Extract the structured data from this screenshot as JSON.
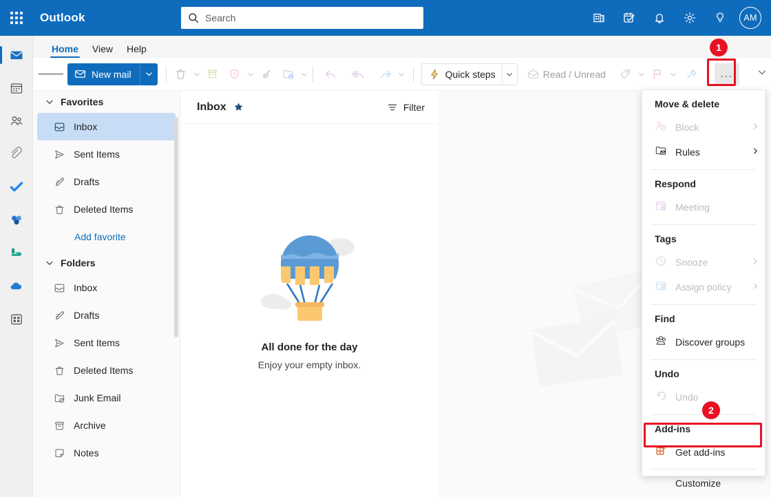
{
  "topbar": {
    "waffle_label": "App launcher",
    "brand": "Outlook",
    "search_placeholder": "Search",
    "search_value": "",
    "icons": [
      "teams-icon",
      "todo-tasks-icon",
      "notifications-bell-icon",
      "settings-gear-icon",
      "tips-lightbulb-icon"
    ],
    "avatar_initials": "AM"
  },
  "rail": {
    "items": [
      {
        "name": "mail",
        "active": true
      },
      {
        "name": "calendar",
        "active": false
      },
      {
        "name": "people",
        "active": false
      },
      {
        "name": "files",
        "active": false
      },
      {
        "name": "to-do",
        "active": false
      },
      {
        "name": "viva-engage",
        "active": false
      },
      {
        "name": "bookings",
        "active": false
      },
      {
        "name": "onedrive",
        "active": false
      },
      {
        "name": "apps",
        "active": false
      }
    ]
  },
  "ribbon": {
    "tabs": [
      {
        "label": "Home",
        "active": true
      },
      {
        "label": "View",
        "active": false
      },
      {
        "label": "Help",
        "active": false
      }
    ]
  },
  "toolbar": {
    "new_mail": "New mail",
    "delete_label": "Delete",
    "archive_label": "Archive",
    "report_label": "Report",
    "sweep_label": "Sweep",
    "move_to_label": "Move to",
    "reply_label": "Reply",
    "reply_all_label": "Reply all",
    "forward_label": "Forward",
    "quick_steps": "Quick steps",
    "read_unread": "Read / Unread",
    "categorize_label": "Categorize",
    "flag_label": "Flag",
    "pin_label": "Pin",
    "more_label": "...",
    "collapse_label": "Collapse ribbon"
  },
  "folder_pane": {
    "favorites": {
      "title": "Favorites",
      "items": [
        {
          "label": "Inbox",
          "icon": "inbox-icon",
          "selected": true
        },
        {
          "label": "Sent Items",
          "icon": "send-icon",
          "selected": false
        },
        {
          "label": "Drafts",
          "icon": "drafts-icon",
          "selected": false
        },
        {
          "label": "Deleted Items",
          "icon": "trash-icon",
          "selected": false
        }
      ],
      "add_favorite": "Add favorite"
    },
    "folders": {
      "title": "Folders",
      "items": [
        {
          "label": "Inbox",
          "icon": "inbox-icon"
        },
        {
          "label": "Drafts",
          "icon": "drafts-icon"
        },
        {
          "label": "Sent Items",
          "icon": "send-icon"
        },
        {
          "label": "Deleted Items",
          "icon": "trash-icon"
        },
        {
          "label": "Junk Email",
          "icon": "junk-folder-icon"
        },
        {
          "label": "Archive",
          "icon": "archive-icon"
        },
        {
          "label": "Notes",
          "icon": "notes-icon"
        }
      ]
    }
  },
  "message_list": {
    "title": "Inbox",
    "favorite_star": "star-icon",
    "filter_label": "Filter",
    "empty_title": "All done for the day",
    "empty_subtitle": "Enjoy your empty inbox."
  },
  "flyout_menu": {
    "sections": [
      {
        "title": "Move & delete",
        "items": [
          {
            "label": "Block",
            "icon": "block-person-icon",
            "disabled": true,
            "submenu": true
          },
          {
            "label": "Rules",
            "icon": "rules-folder-icon",
            "disabled": false,
            "submenu": true
          }
        ]
      },
      {
        "title": "Respond",
        "items": [
          {
            "label": "Meeting",
            "icon": "meeting-calendar-icon",
            "disabled": true,
            "submenu": false
          }
        ]
      },
      {
        "title": "Tags",
        "items": [
          {
            "label": "Snooze",
            "icon": "clock-icon",
            "disabled": true,
            "submenu": true
          },
          {
            "label": "Assign policy",
            "icon": "assign-policy-icon",
            "disabled": true,
            "submenu": true
          }
        ]
      },
      {
        "title": "Find",
        "items": [
          {
            "label": "Discover groups",
            "icon": "people-group-icon",
            "disabled": false,
            "submenu": false
          }
        ]
      },
      {
        "title": "Undo",
        "items": [
          {
            "label": "Undo",
            "icon": "undo-arrow-icon",
            "disabled": true,
            "submenu": false
          }
        ]
      },
      {
        "title": "Add-ins",
        "items": [
          {
            "label": "Get add-ins",
            "icon": "get-addins-icon",
            "disabled": false,
            "submenu": false
          }
        ]
      }
    ],
    "customize_label": "Customize"
  },
  "callouts": [
    {
      "number": "1",
      "target": "more-options-button"
    },
    {
      "number": "2",
      "target": "get-add-ins-menu-item"
    }
  ],
  "colors": {
    "brand_blue": "#0f6cbd",
    "highlight_red": "#e81123",
    "selected_folder": "#c7dcf5",
    "rail_bg": "#f0f0f0"
  }
}
